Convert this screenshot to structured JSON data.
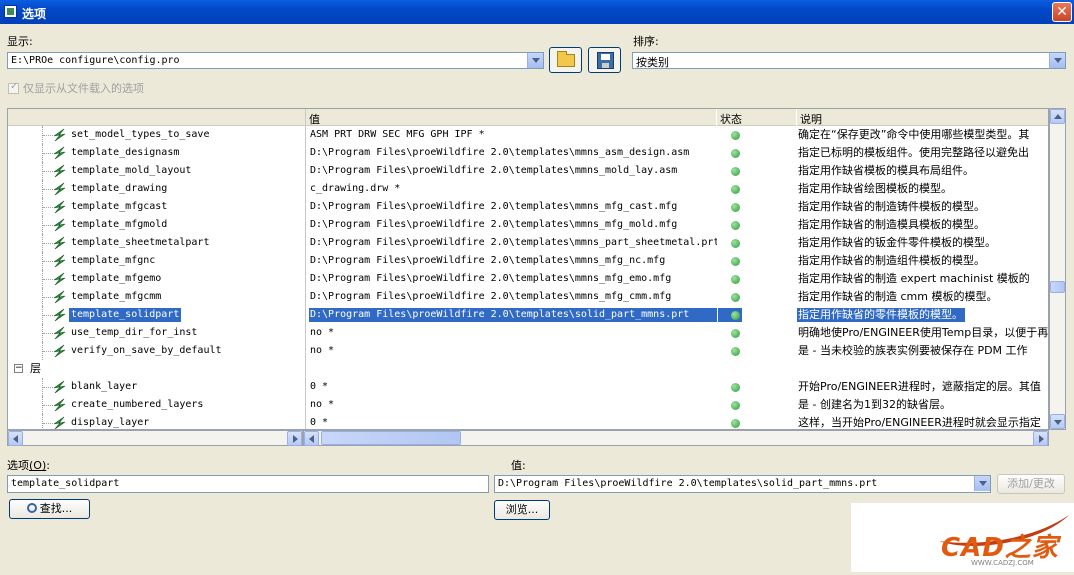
{
  "window": {
    "title": "选项",
    "close_glyph": "✕"
  },
  "display": {
    "label": "显示:",
    "file_path": "E:\\PROe configure\\config.pro"
  },
  "sort": {
    "label": "排序:",
    "value": "按类别"
  },
  "only_from_file": {
    "label": "仅显示从文件载入的选项",
    "checked": true
  },
  "columns": {
    "name": "",
    "value": "值",
    "status": "状态",
    "description": "说明"
  },
  "rows": [
    {
      "name": "set_model_types_to_save",
      "value": "ASM PRT DRW SEC MFG GPH IPF *",
      "status": "green",
      "desc": "确定在“保存更改”命令中使用哪些模型类型。其"
    },
    {
      "name": "template_designasm",
      "value": "D:\\Program Files\\proeWildfire 2.0\\templates\\mmns_asm_design.asm",
      "status": "green",
      "desc": "指定已标明的模板组件。使用完整路径以避免出"
    },
    {
      "name": "template_mold_layout",
      "value": "D:\\Program Files\\proeWildfire 2.0\\templates\\mmns_mold_lay.asm",
      "status": "green",
      "desc": "指定用作缺省模板的模具布局组件。"
    },
    {
      "name": "template_drawing",
      "value": "c_drawing.drw *",
      "status": "green",
      "desc": "指定用作缺省绘图模板的模型。"
    },
    {
      "name": "template_mfgcast",
      "value": "D:\\Program Files\\proeWildfire 2.0\\templates\\mmns_mfg_cast.mfg",
      "status": "green",
      "desc": "指定用作缺省的制造铸件模板的模型。"
    },
    {
      "name": "template_mfgmold",
      "value": "D:\\Program Files\\proeWildfire 2.0\\templates\\mmns_mfg_mold.mfg",
      "status": "green",
      "desc": "指定用作缺省的制造模具模板的模型。"
    },
    {
      "name": "template_sheetmetalpart",
      "value": "D:\\Program Files\\proeWildfire 2.0\\templates\\mmns_part_sheetmetal.prt",
      "status": "green",
      "desc": "指定用作缺省的钣金件零件模板的模型。"
    },
    {
      "name": "template_mfgnc",
      "value": "D:\\Program Files\\proeWildfire 2.0\\templates\\mmns_mfg_nc.mfg",
      "status": "green",
      "desc": "指定用作缺省的制造组件模板的模型。"
    },
    {
      "name": "template_mfgemo",
      "value": "D:\\Program Files\\proeWildfire 2.0\\templates\\mmns_mfg_emo.mfg",
      "status": "green",
      "desc": "指定用作缺省的制造 expert machinist 模板的"
    },
    {
      "name": "template_mfgcmm",
      "value": "D:\\Program Files\\proeWildfire 2.0\\templates\\mmns_mfg_cmm.mfg",
      "status": "green",
      "desc": "指定用作缺省的制造 cmm 模板的模型。"
    },
    {
      "name": "template_solidpart",
      "value": "D:\\Program Files\\proeWildfire 2.0\\templates\\solid_part_mmns.prt",
      "status": "green",
      "desc": "指定用作缺省的零件模板的模型。",
      "selected": true
    },
    {
      "name": "use_temp_dir_for_inst",
      "value": "no *",
      "status": "green",
      "desc": "明确地使Pro/ENGINEER使用Temp目录，以便于再"
    },
    {
      "name": "verify_on_save_by_default",
      "value": "no *",
      "status": "green",
      "desc": "是 - 当未校验的族表实例要被保存在 PDM 工作"
    },
    {
      "category": "层"
    },
    {
      "name": "blank_layer",
      "value": "0 *",
      "status": "green",
      "desc": "开始Pro/ENGINEER进程时，遮蔽指定的层。其值"
    },
    {
      "name": "create_numbered_layers",
      "value": "no *",
      "status": "green",
      "desc": "是 - 创建名为1到32的缺省层。"
    },
    {
      "name": "display_layer",
      "value": "0 *",
      "status": "green",
      "desc": "这样，当开始Pro/ENGINEER进程时就会显示指定"
    }
  ],
  "option_field": {
    "label": "选项",
    "shortcut": "(O)",
    "colon": ":",
    "value": "template_solidpart"
  },
  "value_field": {
    "label": "值:",
    "value": "D:\\Program Files\\proeWildfire 2.0\\templates\\solid_part_mmns.prt"
  },
  "buttons": {
    "add_change": "添加/更改",
    "find": "查找...",
    "browse": "浏览..."
  },
  "watermark": {
    "brand": "CAD之家",
    "url": "WWW.CADZJ.COM"
  }
}
